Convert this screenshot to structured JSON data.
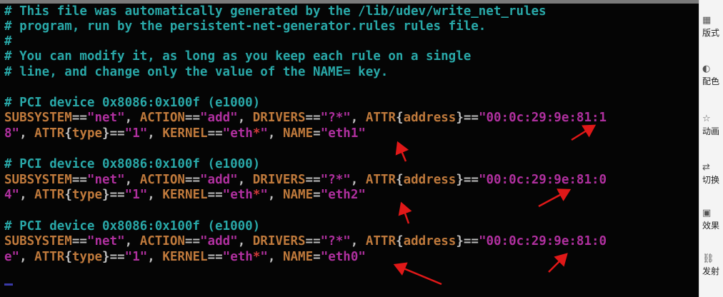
{
  "terminal": {
    "comments": [
      "# This file was automatically generated by the /lib/udev/write_net_rules",
      "# program, run by the persistent-net-generator.rules rules file.",
      "#",
      "# You can modify it, as long as you keep each rule on a single",
      "# line, and change only the value of the NAME= key."
    ],
    "rules": [
      {
        "header": "# PCI device 0x8086:0x100f (e1000)",
        "subsystem": "net",
        "action": "add",
        "drivers": "?*",
        "address_line1": "00:0c:29:9e:81:1",
        "address_line2": "8",
        "type": "1",
        "kernel": "eth",
        "name": "eth1"
      },
      {
        "header": "# PCI device 0x8086:0x100f (e1000)",
        "subsystem": "net",
        "action": "add",
        "drivers": "?*",
        "address_line1": "00:0c:29:9e:81:0",
        "address_line2": "4",
        "type": "1",
        "kernel": "eth",
        "name": "eth2"
      },
      {
        "header": "# PCI device 0x8086:0x100f (e1000)",
        "subsystem": "net",
        "action": "add",
        "drivers": "?*",
        "address_line1": "00:0c:29:9e:81:0",
        "address_line2": "e",
        "type": "1",
        "kernel": "eth",
        "name": "eth0"
      }
    ]
  },
  "sidebar": {
    "items": [
      {
        "icon": "grid-icon",
        "label": "版式"
      },
      {
        "icon": "palette-icon",
        "label": "配色"
      },
      {
        "icon": "animation-star-icon",
        "label": "动画"
      },
      {
        "icon": "transition-icon",
        "label": "切换"
      },
      {
        "icon": "effects-icon",
        "label": "效果"
      },
      {
        "icon": "link-icon",
        "label": "发射"
      }
    ]
  },
  "colors": {
    "background": "#050505",
    "comment": "#29a8a8",
    "key": "#c07a3c",
    "string": "#b0309f",
    "punct": "#bfbfbf",
    "star": "#d23a3a",
    "arrow": "#e01818"
  }
}
